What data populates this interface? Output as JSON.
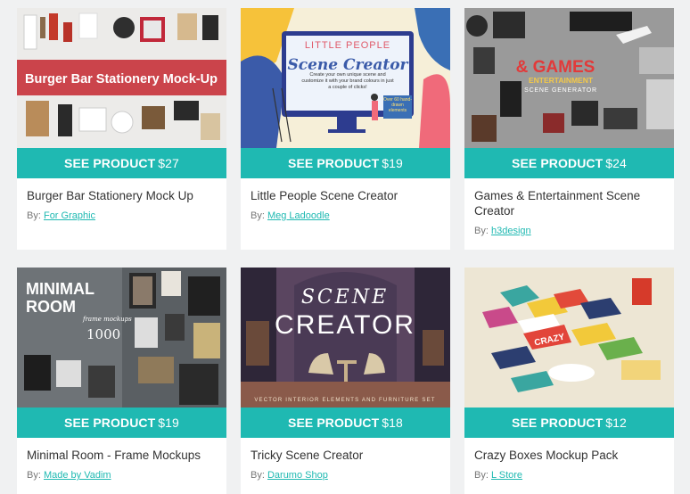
{
  "cards": [
    {
      "thumb_text": "Burger Bar Stationery Mock-Up",
      "button_label": "SEE PRODUCT",
      "price": "$27",
      "title": "Burger Bar Stationery Mock Up",
      "by_label": "By:",
      "author": "For Graphic"
    },
    {
      "thumb_text_1": "LITTLE PEOPLE",
      "thumb_text_2": "Scene Creator",
      "thumb_text_3": "Create your own unique scene and customize it with your brand colours in just a couple of clicks!",
      "thumb_text_4": "Over 60 hand-drawn elements",
      "button_label": "SEE PRODUCT",
      "price": "$19",
      "title": "Little People Scene Creator",
      "by_label": "By:",
      "author": "Meg Ladoodle"
    },
    {
      "thumb_text_1": "& GAMES",
      "thumb_text_2": "ENTERTAINMENT",
      "thumb_text_3": "SCENE GENERATOR",
      "button_label": "SEE PRODUCT",
      "price": "$24",
      "title": "Games & Entertainment Scene Creator",
      "by_label": "By:",
      "author": "h3design"
    },
    {
      "thumb_text_1": "MINIMAL",
      "thumb_text_2": "ROOM",
      "thumb_text_3": "frame mockups",
      "thumb_text_4": "1000",
      "button_label": "SEE PRODUCT",
      "price": "$19",
      "title": "Minimal Room - Frame Mockups",
      "by_label": "By:",
      "author": "Made by Vadim"
    },
    {
      "thumb_text_1": "SCENE",
      "thumb_text_2": "CREATOR",
      "thumb_text_3": "VECTOR INTERIOR ELEMENTS AND FURNITURE SET",
      "button_label": "SEE PRODUCT",
      "price": "$18",
      "title": "Tricky Scene Creator",
      "by_label": "By:",
      "author": "Darumo Shop"
    },
    {
      "thumb_text_1": "CRAZY",
      "button_label": "SEE PRODUCT",
      "price": "$12",
      "title": "Crazy Boxes Mockup Pack",
      "by_label": "By:",
      "author": "L Store"
    }
  ],
  "colors": {
    "accent": "#1fb9b2",
    "burger_banner": "#c8323a"
  }
}
